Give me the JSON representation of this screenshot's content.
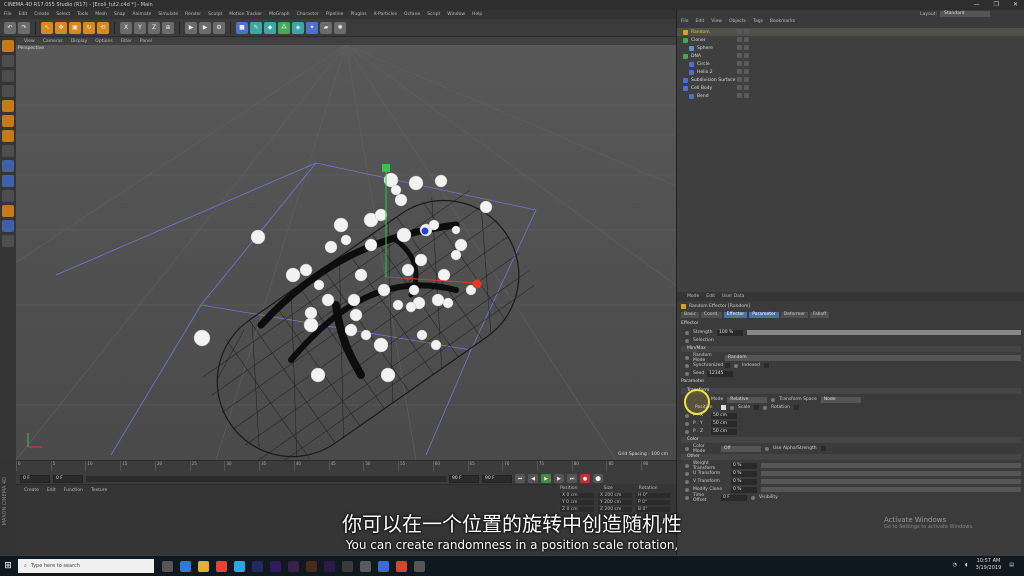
{
  "window": {
    "title": "CINEMA 4D R17.055 Studio (R17) - [Ecoli_tut2.c4d *] - Main",
    "controls": [
      "—",
      "❐",
      "✕"
    ]
  },
  "menu": [
    "File",
    "Edit",
    "Create",
    "Select",
    "Tools",
    "Mesh",
    "Snap",
    "Animate",
    "Simulate",
    "Render",
    "Sculpt",
    "Motion Tracker",
    "MoGraph",
    "Character",
    "Pipeline",
    "Plugins",
    "X-Particles",
    "Octane",
    "Script",
    "Window",
    "Help"
  ],
  "toolbar_xyz": [
    "X",
    "Y",
    "Z"
  ],
  "viewport": {
    "menu": [
      "View",
      "Cameras",
      "Display",
      "Options",
      "Filter",
      "Panel"
    ],
    "label": "Perspective",
    "grid_spacing": "Grid Spacing : 100 cm"
  },
  "timeline": {
    "ticks": [
      "0",
      "5",
      "10",
      "15",
      "20",
      "25",
      "30",
      "35",
      "40",
      "45",
      "50",
      "55",
      "60",
      "65",
      "70",
      "75",
      "80",
      "85",
      "90"
    ],
    "frame_start": "0 F",
    "frame_current": "0 F",
    "frame_end": "90 F",
    "frame_end2": "90 F"
  },
  "materials": {
    "menu": [
      "Create",
      "Edit",
      "Function",
      "Texture"
    ]
  },
  "coords": {
    "headers": [
      "Position",
      "Size",
      "Rotation"
    ],
    "rows": [
      [
        "X 0 cm",
        "X 200 cm",
        "H 0°"
      ],
      [
        "Y 0 cm",
        "Y 200 cm",
        "P 0°"
      ],
      [
        "Z 0 cm",
        "Z 200 cm",
        "B 0°"
      ]
    ]
  },
  "leftstrip_label": "MAXON CINEMA 4D",
  "layout": {
    "label": "Layout:",
    "value": "Standard"
  },
  "objects": {
    "menu": [
      "File",
      "Edit",
      "View",
      "Objects",
      "Tags",
      "Bookmarks"
    ],
    "items": [
      {
        "name": "Random",
        "indent": 0,
        "color": "#d0a030",
        "active": true
      },
      {
        "name": "Cloner",
        "indent": 0,
        "color": "#43a95a",
        "active": false
      },
      {
        "name": "Sphere",
        "indent": 1,
        "color": "#4b9fd0",
        "active": false
      },
      {
        "name": "DNA",
        "indent": 0,
        "color": "#43a95a",
        "active": false
      },
      {
        "name": "Circle",
        "indent": 1,
        "color": "#4b73c9",
        "active": false
      },
      {
        "name": "Helix.2",
        "indent": 1,
        "color": "#4b73c9",
        "active": false
      },
      {
        "name": "Subdivision Surface",
        "indent": 0,
        "color": "#4b73c9",
        "active": false
      },
      {
        "name": "Cell Body",
        "indent": 0,
        "color": "#4b73c9",
        "active": false
      },
      {
        "name": "Bend",
        "indent": 1,
        "color": "#4b73c9",
        "active": false
      }
    ]
  },
  "attributes": {
    "menu": [
      "Mode",
      "Edit",
      "User Data"
    ],
    "title": "Random Effector [Random]",
    "tabs": [
      "Basic",
      "Coord.",
      "Effector",
      "Parameter",
      "Deformer",
      "Falloff"
    ],
    "active_tab": "Parameter",
    "effector_header": "Effector",
    "strength_label": "Strength",
    "strength_value": "100 %",
    "strength": 1.0,
    "selection_label": "Selection",
    "minmax_header": "Min/Max",
    "random_mode_label": "Random Mode",
    "random_mode_value": "Random",
    "synchronized_label": "Synchronized",
    "indexed_label": "Indexed",
    "seed_label": "Seed",
    "seed_value": "12345",
    "parameter_header": "Parameter",
    "transform_header": "Transform",
    "mode_label": "Mode",
    "mode_value": "Relative",
    "transform_space_label": "Transform Space",
    "transform_space_value": "Node",
    "position_label": "Position",
    "scale_label": "Scale",
    "rotation_label": "Rotation",
    "px_label": "P . X",
    "px_value": "50 cm",
    "py_label": "P . Y",
    "py_value": "50 cm",
    "pz_label": "P . Z",
    "pz_value": "50 cm",
    "color_header": "Color",
    "color_mode_label": "Color Mode",
    "color_mode_value": "Off",
    "use_alpha_label": "Use Alpha/Strength",
    "other_header": "Other",
    "weight_label": "Weight Transform",
    "weight_value": "0 %",
    "u_label": "U Transform",
    "u_value": "0 %",
    "v_label": "V Transform",
    "v_value": "0 %",
    "modify_label": "Modify Clone",
    "modify_value": "0 %",
    "time_label": "Time Offset",
    "time_value": "0 F",
    "visibility_label": "Visibility"
  },
  "subtitles": {
    "zh": "你可以在一个位置的旋转中创造随机性",
    "en": "You can create randomness in a position scale rotation,"
  },
  "activate": {
    "title": "Activate Windows",
    "sub": "Go to Settings to activate Windows."
  },
  "taskbar": {
    "search": "Type here to search",
    "time": "10:57 AM",
    "date": "3/19/2019"
  }
}
